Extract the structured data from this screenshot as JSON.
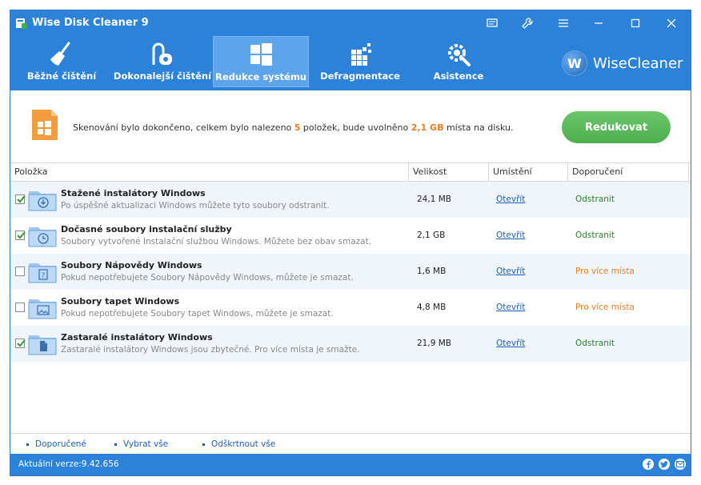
{
  "window": {
    "title": "Wise Disk Cleaner 9"
  },
  "tabs": [
    {
      "label": "Běžné čištění",
      "icon": "broom-icon"
    },
    {
      "label": "Dokonalejší čištění",
      "icon": "vacuum-icon"
    },
    {
      "label": "Redukce systému",
      "icon": "windows-icon",
      "active": true
    },
    {
      "label": "Defragmentace",
      "icon": "defrag-icon"
    },
    {
      "label": "Asistence",
      "icon": "gear-wrench-icon"
    }
  ],
  "brand": {
    "letter": "W",
    "name": "WiseCleaner"
  },
  "summary": {
    "text_before": "Skenování bylo dokončeno, celkem bylo nalezeno ",
    "count": "5",
    "text_middle": " položek, bude uvolněno ",
    "size": "2,1 GB",
    "text_after": " místa na disku.",
    "button": "Redukovat"
  },
  "table": {
    "headers": {
      "item": "Položka",
      "size": "Velikost",
      "location": "Umístění",
      "recommendation": "Doporučení"
    },
    "rows": [
      {
        "checked": true,
        "icon": "download-icon",
        "title": "Stažené instalátory Windows",
        "desc": "Po úspěšné aktualizaci Windows můžete tyto soubory odstranit.",
        "size": "24,1 MB",
        "location": "Otevřít",
        "recommendation": "Odstranit",
        "rec_type": "remove"
      },
      {
        "checked": true,
        "icon": "clock-icon",
        "title": "Dočasné soubory instalační služby",
        "desc": "Soubory vytvořené Instalační službou Windows. Můžete bez obav smazat.",
        "size": "2,1 GB",
        "location": "Otevřít",
        "recommendation": "Odstranit",
        "rec_type": "remove"
      },
      {
        "checked": false,
        "icon": "help-file-icon",
        "title": "Soubory Nápovědy Windows",
        "desc": "Pokud nepotřebujete Soubory Nápovědy Windows, můžete je smazat.",
        "size": "1,6 MB",
        "location": "Otevřít",
        "recommendation": "Pro více místa",
        "rec_type": "space"
      },
      {
        "checked": false,
        "icon": "image-icon",
        "title": "Soubory tapet Windows",
        "desc": "Pokud nepotřebujete Soubory tapet Windows, můžete je smazat.",
        "size": "4,8 MB",
        "location": "Otevřít",
        "recommendation": "Pro více místa",
        "rec_type": "space"
      },
      {
        "checked": true,
        "icon": "document-icon",
        "title": "Zastaralé instalátory Windows",
        "desc": "Zastaralé instalátory Windows jsou zbytečné. Pro více místa je smažte.",
        "size": "21,9 MB",
        "location": "Otevřít",
        "recommendation": "Odstranit",
        "rec_type": "remove"
      }
    ]
  },
  "bottom_links": {
    "recommended": "Doporučené",
    "select_all": "Vybrat vše",
    "deselect_all": "Odškrtnout vše"
  },
  "status": {
    "version": "Aktuální verze:9.42.656"
  },
  "colors": {
    "accent": "#2b82d8",
    "button": "#5cb85c",
    "highlight": "#e67e22",
    "remove": "#2e7d32"
  }
}
